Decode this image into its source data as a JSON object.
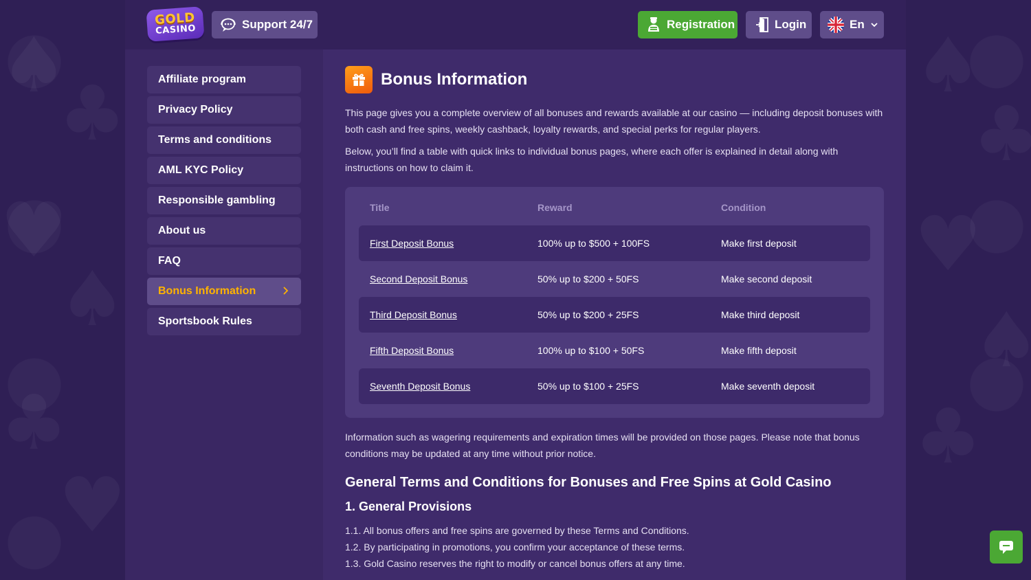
{
  "header": {
    "logo_top": "GOLD",
    "logo_bottom": "CASINO",
    "support_label": "Support 24/7",
    "registration_label": "Registration",
    "login_label": "Login",
    "language_label": "En"
  },
  "sidebar": {
    "items": [
      {
        "label": "Affiliate program"
      },
      {
        "label": "Privacy Policy"
      },
      {
        "label": "Terms and conditions"
      },
      {
        "label": "AML KYC Policy"
      },
      {
        "label": "Responsible gambling"
      },
      {
        "label": "About us"
      },
      {
        "label": "FAQ"
      },
      {
        "label": "Bonus Information"
      },
      {
        "label": "Sportsbook Rules"
      }
    ],
    "active_index": 7
  },
  "main": {
    "title": "Bonus Information",
    "intro_1": "This page gives you a complete overview of all bonuses and rewards available at our casino — including deposit bonuses with both cash and free spins, weekly cashback, loyalty rewards, and special perks for regular players.",
    "intro_2": "Below, you’ll find a table with quick links to individual bonus pages, where each offer is explained in detail along with instructions on how to claim it.",
    "table": {
      "headers": [
        "Title",
        "Reward",
        "Condition"
      ],
      "rows": [
        {
          "title": "First Deposit Bonus",
          "reward": "100% up to $500 + 100FS",
          "condition": "Make first deposit"
        },
        {
          "title": "Second Deposit Bonus",
          "reward": "50% up to $200 + 50FS",
          "condition": "Make second deposit"
        },
        {
          "title": "Third Deposit Bonus",
          "reward": "50% up to $200 + 25FS",
          "condition": "Make third deposit"
        },
        {
          "title": "Fifth Deposit Bonus",
          "reward": "100% up to $100 + 50FS",
          "condition": "Make fifth deposit"
        },
        {
          "title": "Seventh Deposit Bonus",
          "reward": "50% up to $100 + 25FS",
          "condition": "Make seventh deposit"
        }
      ]
    },
    "info_note": "Information such as wagering requirements and expiration times will be provided on those pages. Please note that bonus conditions may be updated at any time without prior notice.",
    "terms_heading": "General Terms and Conditions for Bonuses and Free Spins at Gold Casino",
    "section_heading": "1. General Provisions",
    "terms": [
      "1.1. All bonus offers and free spins are governed by these Terms and Conditions.",
      "1.2. By participating in promotions, you confirm your acceptance of these terms.",
      "1.3. Gold Casino reserves the right to modify or cancel bonus offers at any time."
    ]
  },
  "colors": {
    "accent_green": "#4ba834",
    "active_text": "#ffb300",
    "gift_icon": "#f47a12"
  },
  "icons": [
    "support-chat-icon",
    "registration-user-icon",
    "login-door-icon",
    "uk-flag-icon",
    "chevron-down-icon",
    "gift-icon",
    "chevron-right-icon",
    "chat-bubble-icon"
  ]
}
